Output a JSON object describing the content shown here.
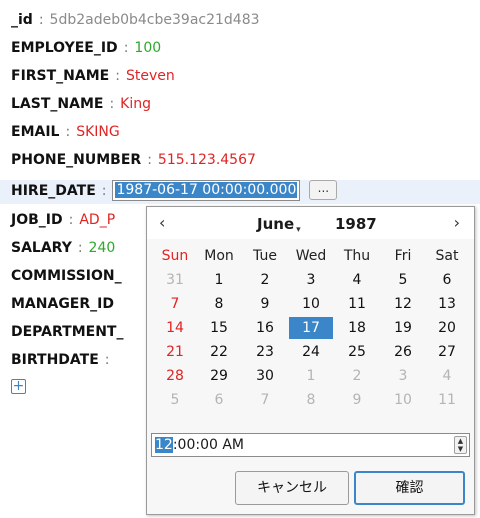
{
  "document": {
    "fields": [
      {
        "key": "_id",
        "value": "5db2adeb0b4cbe39ac21d483",
        "value_color": "#8a8a8a"
      },
      {
        "key": "EMPLOYEE_ID",
        "value": "100",
        "value_color": "#2ea82e"
      },
      {
        "key": "FIRST_NAME",
        "value": "Steven",
        "value_color": "#e02424"
      },
      {
        "key": "LAST_NAME",
        "value": "King",
        "value_color": "#e02424"
      },
      {
        "key": "EMAIL",
        "value": "SKING",
        "value_color": "#e02424"
      },
      {
        "key": "PHONE_NUMBER",
        "value": "515.123.4567",
        "value_color": "#e02424"
      },
      {
        "key": "HIRE_DATE",
        "value": "1987-06-17 00:00:00.000",
        "editing": true
      },
      {
        "key": "JOB_ID",
        "value": "AD_P",
        "value_color": "#e02424"
      },
      {
        "key": "SALARY",
        "value": "240",
        "value_color": "#2ea82e"
      },
      {
        "key": "COMMISSION_",
        "value": ""
      },
      {
        "key": "MANAGER_ID",
        "value": ""
      },
      {
        "key": "DEPARTMENT_",
        "value": ""
      },
      {
        "key": "BIRTHDATE",
        "value": ""
      }
    ],
    "separator": ":",
    "edit_button_label": "...",
    "add_button_label": "+"
  },
  "calendar": {
    "prev": "‹",
    "next": "›",
    "month": "June",
    "year": "1987",
    "weekdays": [
      "Sun",
      "Mon",
      "Tue",
      "Wed",
      "Thu",
      "Fri",
      "Sat"
    ],
    "weeks": [
      [
        "31",
        "1",
        "2",
        "3",
        "4",
        "5",
        "6"
      ],
      [
        "7",
        "8",
        "9",
        "10",
        "11",
        "12",
        "13"
      ],
      [
        "14",
        "15",
        "16",
        "17",
        "18",
        "19",
        "20"
      ],
      [
        "21",
        "22",
        "23",
        "24",
        "25",
        "26",
        "27"
      ],
      [
        "28",
        "29",
        "30",
        "1",
        "2",
        "3",
        "4"
      ],
      [
        "5",
        "6",
        "7",
        "8",
        "9",
        "10",
        "11"
      ]
    ],
    "selected_day": "17",
    "time_selected_part": "12",
    "time_rest": ":00:00 AM",
    "cancel_label": "キャンセル",
    "ok_label": "確認"
  }
}
